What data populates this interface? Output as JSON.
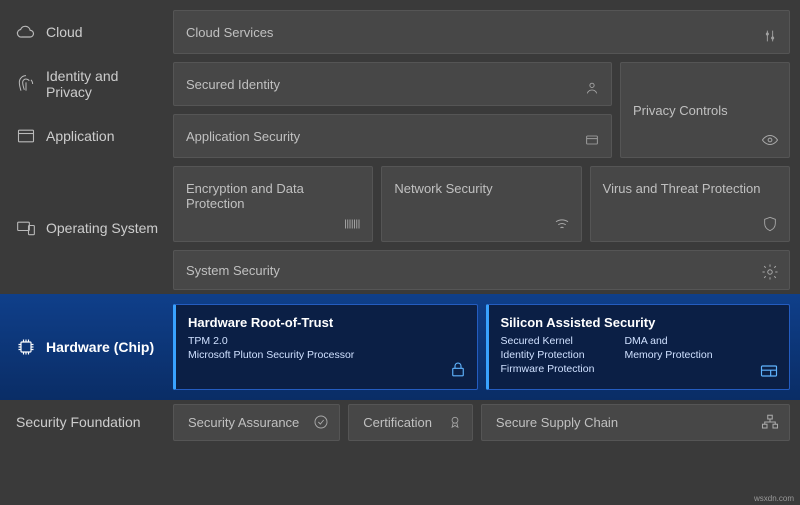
{
  "layers": {
    "cloud": {
      "label": "Cloud"
    },
    "identity": {
      "label": "Identity and Privacy"
    },
    "application": {
      "label": "Application"
    },
    "os": {
      "label": "Operating System"
    },
    "hardware": {
      "label": "Hardware (Chip)"
    },
    "foundation": {
      "label": "Security Foundation"
    }
  },
  "cards": {
    "cloud_services": "Cloud Services",
    "secured_identity": "Secured Identity",
    "privacy_controls": "Privacy Controls",
    "application_security": "Application Security",
    "encryption": "Encryption and Data Protection",
    "network_security": "Network Security",
    "virus": "Virus and Threat Protection",
    "system_security": "System Security"
  },
  "hw": {
    "root": {
      "title": "Hardware Root-of-Trust",
      "line1": "TPM 2.0",
      "line2": "Microsoft Pluton Security Processor"
    },
    "silicon": {
      "title": "Silicon Assisted Security",
      "colA": [
        "Secured Kernel",
        "Identity Protection",
        "Firmware Protection"
      ],
      "colB": [
        "DMA and",
        "Memory Protection"
      ]
    }
  },
  "foundation": {
    "assurance": "Security Assurance",
    "certification": "Certification",
    "supply": "Secure Supply Chain"
  },
  "watermark": "wsxdn.com"
}
